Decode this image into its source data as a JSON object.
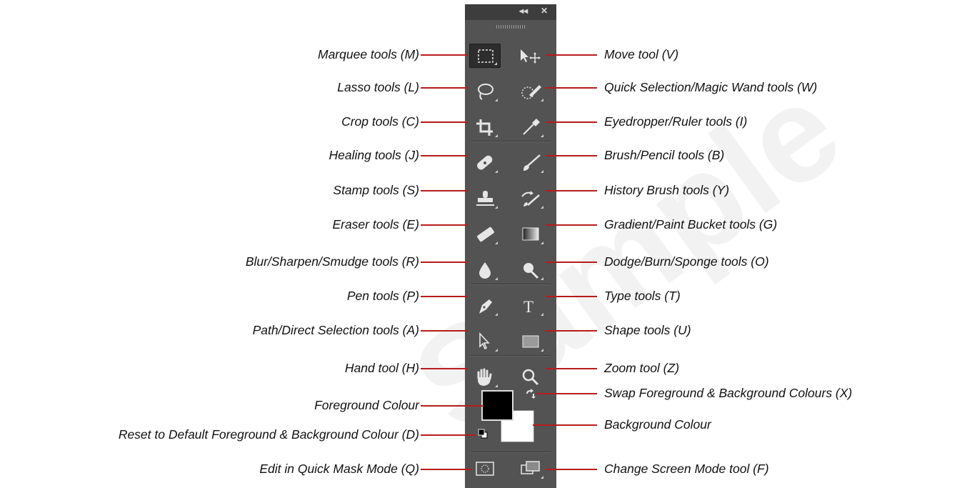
{
  "panel": {
    "collapse_glyph": "◂◂",
    "close_glyph": "✕"
  },
  "left_labels": [
    "Marquee tools (M)",
    "Lasso tools (L)",
    "Crop tools (C)",
    "Healing tools (J)",
    "Stamp tools (S)",
    "Eraser tools (E)",
    "Blur/Sharpen/Smudge tools (R)",
    "Pen tools (P)",
    "Path/Direct Selection tools (A)",
    "Hand tool (H)",
    "Foreground Colour",
    "Reset to Default Foreground & Background Colour (D)",
    "Edit in Quick Mask Mode (Q)"
  ],
  "right_labels": [
    "Move tool (V)",
    "Quick Selection/Magic Wand tools (W)",
    "Eyedropper/Ruler tools (I)",
    "Brush/Pencil tools (B)",
    "History Brush tools (Y)",
    "Gradient/Paint Bucket tools (G)",
    "Dodge/Burn/Sponge tools (O)",
    "Type tools (T)",
    "Shape tools (U)",
    "Zoom tool (Z)",
    "Swap Foreground & Background Colours (X)",
    "Background Colour",
    "Change Screen Mode tool (F)"
  ],
  "colors": {
    "panel_bg": "#535353",
    "leader_line": "#b71c1c",
    "icon": "#e6e6e6",
    "foreground_swatch": "#000000",
    "background_swatch": "#ffffff"
  },
  "watermark": "Sample"
}
